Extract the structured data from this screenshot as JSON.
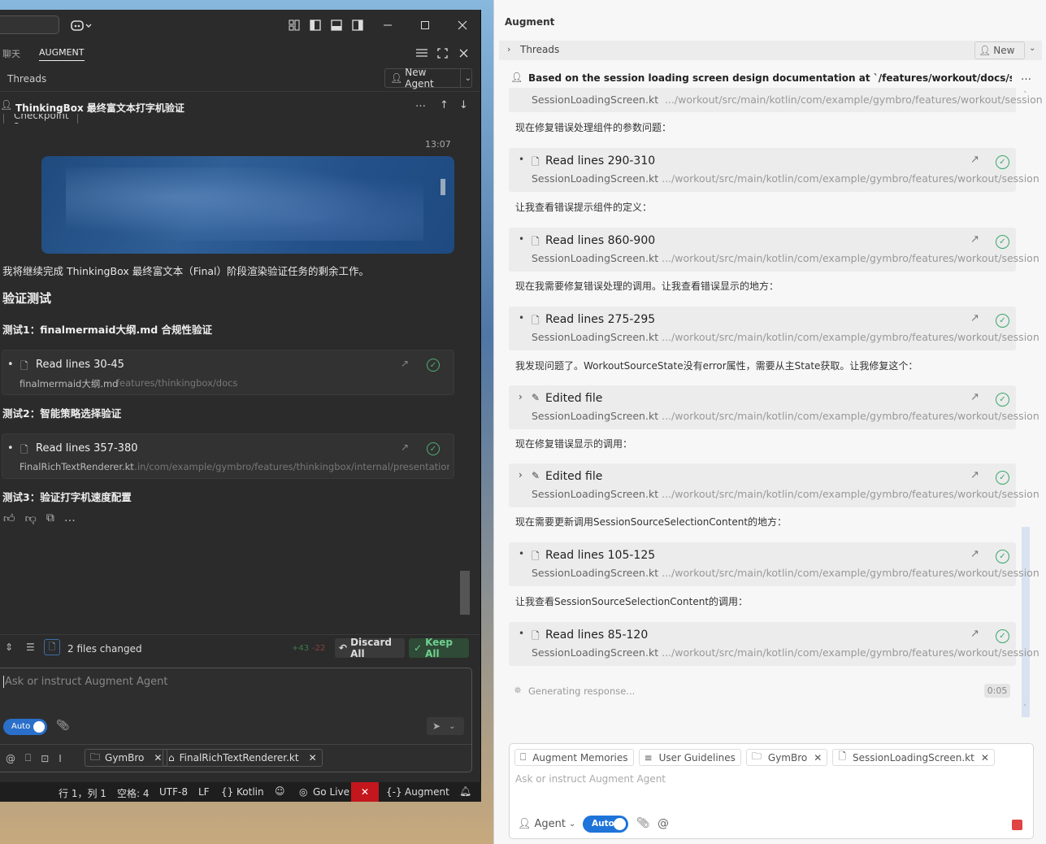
{
  "left": {
    "tabs": [
      "聊天",
      "AUGMENT"
    ],
    "threads_label": "Threads",
    "new_agent": "New Agent",
    "thread_title": "ThinkingBox 最终富文本打字机验证",
    "checkpoint": "Checkpoint 2",
    "time": "13:07",
    "intro": "我将继续完成 ThinkingBox 最终富文本（Final）阶段渲染验证任务的剩余工作。",
    "heading": "验证测试",
    "test1": "测试1：finalmermaid大纲.md 合规性验证",
    "card1": {
      "title": "Read lines 30-45",
      "file": "finalmermaid大纲.md",
      "path": "features/thinkingbox/docs"
    },
    "test2": "测试2：智能策略选择验证",
    "card2": {
      "title": "Read lines 357-380",
      "file": "FinalRichTextRenderer.kt",
      "path": "...in/com/example/gymbro/features/thinkingbox/internal/presentation/ui"
    },
    "test3": "测试3：验证打字机速度配置",
    "files_changed": "2 files changed",
    "added": "+43",
    "removed": "-22",
    "discard_all": "Discard All",
    "keep_all": "Keep All",
    "input_placeholder": "Ask or instruct Augment Agent",
    "auto": "Auto",
    "chip1": "GymBro",
    "chip2": "FinalRichTextRenderer.kt"
  },
  "statusbar": {
    "position": "行 1，列 1",
    "spaces": "空格: 4",
    "encoding": "UTF-8",
    "eol": "LF",
    "lang": "Kotlin",
    "golive": "Go Live",
    "augment": "Augment"
  },
  "right": {
    "title": "Augment",
    "threads": "Threads",
    "new": "New",
    "request": "Based on the session loading screen design documentation at `/features/workout/docs/session/...",
    "top_file": "SessionLoadingScreen.kt",
    "top_path": ".../workout/src/main/kotlin/com/example/gymbro/features/workout/session",
    "items": [
      {
        "msg": "现在修复错误处理组件的参数问题：",
        "title": "Read lines 290-310",
        "file": "SessionLoadingScreen.kt",
        "path": ".../workout/src/main/kotlin/com/example/gymbro/features/workout/session"
      },
      {
        "msg": "让我查看错误提示组件的定义：",
        "title": "Read lines 860-900",
        "file": "SessionLoadingScreen.kt",
        "path": ".../workout/src/main/kotlin/com/example/gymbro/features/workout/session"
      },
      {
        "msg": "现在我需要修复错误处理的调用。让我查看错误显示的地方：",
        "title": "Read lines 275-295",
        "file": "SessionLoadingScreen.kt",
        "path": ".../workout/src/main/kotlin/com/example/gymbro/features/workout/session"
      },
      {
        "msg": "我发现问题了。WorkoutSourceState没有error属性，需要从主State获取。让我修复这个：",
        "title": "Edited file",
        "file": "SessionLoadingScreen.kt",
        "path": ".../workout/src/main/kotlin/com/example/gymbro/features/workout/session"
      },
      {
        "msg": "现在修复错误显示的调用：",
        "title": "Edited file",
        "file": "SessionLoadingScreen.kt",
        "path": ".../workout/src/main/kotlin/com/example/gymbro/features/workout/session"
      },
      {
        "msg": "现在需要更新调用SessionSourceSelectionContent的地方：",
        "title": "Read lines 105-125",
        "file": "SessionLoadingScreen.kt",
        "path": ".../workout/src/main/kotlin/com/example/gymbro/features/workout/session"
      },
      {
        "msg": "让我查看SessionSourceSelectionContent的调用：",
        "title": "Read lines 85-120",
        "file": "SessionLoadingScreen.kt",
        "path": ".../workout/src/main/kotlin/com/example/gymbro/features/workout/session"
      }
    ],
    "generating": "Generating response...",
    "timer": "0:05",
    "chips": [
      "Augment Memories",
      "User Guidelines",
      "GymBro",
      "SessionLoadingScreen.kt"
    ],
    "input_placeholder": "Ask or instruct Augment Agent",
    "agent": "Agent",
    "auto": "Auto"
  }
}
